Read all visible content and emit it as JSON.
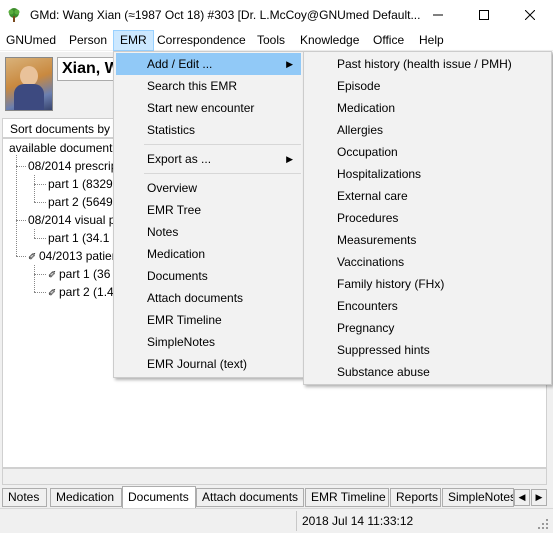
{
  "window": {
    "title": "GMd:  Wang Xian (≈1987 Oct 18) #303 [Dr. L.McCoy@GNUmed Default..."
  },
  "menubar": {
    "items": [
      "GNUmed",
      "Person",
      "EMR",
      "Correspondence",
      "Tools",
      "Knowledge",
      "Office",
      "Help"
    ],
    "active": "EMR"
  },
  "patient": {
    "name": "Xian, W"
  },
  "documents": {
    "sort_label": "Sort documents by",
    "root": "available document",
    "nodes": [
      {
        "label": "08/2014 prescrip",
        "level": 1
      },
      {
        "label": "part  1 (8329",
        "level": 2
      },
      {
        "label": "part  2 (5649",
        "level": 2
      },
      {
        "label": "08/2014 visual p",
        "level": 1
      },
      {
        "label": "part  1 (34.1",
        "level": 2
      },
      {
        "label": "04/2013 patien",
        "level": 1,
        "attachment": true
      },
      {
        "label": "part  1 (36",
        "level": 2,
        "attachment": true
      },
      {
        "label": "part  2 (1.4",
        "level": 2,
        "attachment": true
      }
    ]
  },
  "emr_menu": {
    "group1": [
      "Add / Edit ...",
      "Search this EMR",
      "Start new encounter",
      "Statistics"
    ],
    "group2": [
      "Export as ..."
    ],
    "group3": [
      "Overview",
      "EMR Tree",
      "Notes",
      "Medication",
      "Documents",
      "Attach documents",
      "EMR Timeline",
      "SimpleNotes",
      "EMR Journal (text)"
    ],
    "highlighted": "Add / Edit ..."
  },
  "add_edit_submenu": {
    "items": [
      "Past history (health issue / PMH)",
      "Episode",
      "Medication",
      "Allergies",
      "Occupation",
      "Hospitalizations",
      "External care",
      "Procedures",
      "Measurements",
      "Vaccinations",
      "Family history (FHx)",
      "Encounters",
      "Pregnancy",
      "Suppressed hints",
      "Substance abuse"
    ]
  },
  "tabs": {
    "items": [
      "Notes",
      "Medication",
      "Documents",
      "Attach documents",
      "EMR Timeline",
      "Reports",
      "SimpleNotes"
    ],
    "selected": "Documents"
  },
  "status": {
    "datetime": "2018 Jul 14  11:33:12"
  },
  "icons": {
    "app": "gnumed-tree-icon",
    "submenu_arrow": "chevron-right-icon",
    "attachment": "paperclip-icon"
  },
  "colors": {
    "menu_highlight": "#91c9f7",
    "menubar_active": "#cce8ff"
  }
}
